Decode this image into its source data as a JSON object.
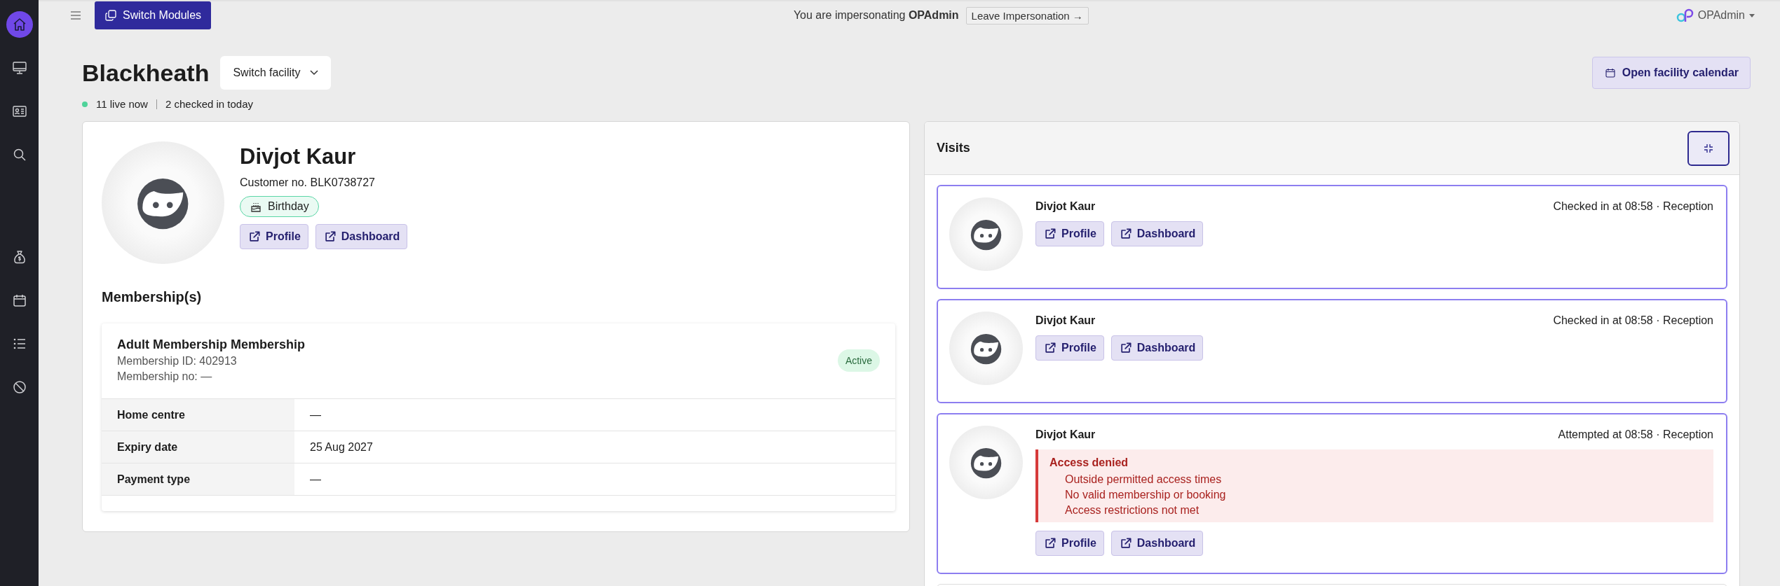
{
  "sidebar": {
    "items": [
      {
        "selected": true
      },
      {
        "selected": false
      },
      {
        "selected": false
      },
      {
        "selected": false
      },
      {
        "selected": false
      },
      {
        "selected": false
      },
      {
        "selected": false
      },
      {
        "selected": false
      }
    ]
  },
  "top_bar": {
    "switch_modules": "Switch Modules",
    "impersonation": "You are impersonating **OPAdmin**",
    "leave_button": "Leave Impersonation →",
    "user_menu": "OPAdmin"
  },
  "header": {
    "title": "Blackheath",
    "switch_facility": "Switch facility",
    "calendar_button": "Open facility calendar",
    "stats": [
      "11 live now",
      "2 checked in today"
    ]
  },
  "customer": {
    "name": "Divjot Kaur",
    "customer_no": "Customer no. BLK0738727",
    "tag": "Birthday",
    "links": [
      "Profile",
      "Dashboard"
    ],
    "memberships_heading": "Membership(s)",
    "memberships": [
      {
        "title": "Adult Membership Membership",
        "id_line": "Membership ID: 402913",
        "no_line": "Membership no: —",
        "status": "Active",
        "fields": [
          {
            "label": "Home centre",
            "value": "—"
          },
          {
            "label": "Expiry date",
            "value": "25 Aug 2027"
          },
          {
            "label": "Payment type",
            "value": "—"
          }
        ]
      }
    ]
  },
  "visits": {
    "title": "Visits",
    "items": [
      {
        "kind": "checked_in",
        "name": "Divjot Kaur",
        "status": "Checked in at 08:58 · Reception",
        "links": [
          "Profile",
          "Dashboard"
        ]
      },
      {
        "kind": "checked_in",
        "name": "Divjot Kaur",
        "status": "Checked in at 08:58 · Reception",
        "links": [
          "Profile",
          "Dashboard"
        ]
      },
      {
        "kind": "denied",
        "name": "Divjot Kaur",
        "status": "Attempted at 08:58 · Reception",
        "alert_title": "Access denied",
        "reasons": [
          "Outside permitted access times",
          "No valid membership or booking",
          "Access restrictions not met"
        ],
        "links": [
          "Profile",
          "Dashboard"
        ]
      },
      {
        "kind": "partial"
      }
    ]
  }
}
